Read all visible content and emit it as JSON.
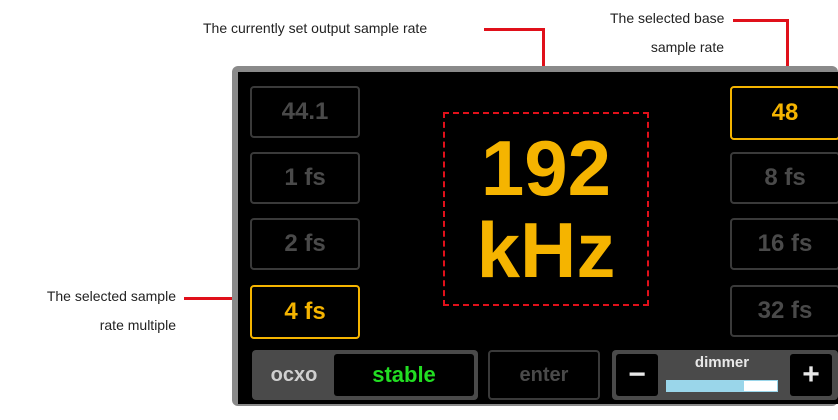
{
  "annotations": {
    "output_rate": "The currently set output sample rate",
    "base_rate_line1": "The selected base",
    "base_rate_line2": "sample rate",
    "multiple_line1": "The selected sample",
    "multiple_line2": "rate multiple"
  },
  "left_buttons": [
    {
      "label": "44.1",
      "selected": false
    },
    {
      "label": "1 fs",
      "selected": false
    },
    {
      "label": "2 fs",
      "selected": false
    },
    {
      "label": "4 fs",
      "selected": true
    }
  ],
  "right_buttons": [
    {
      "label": "48",
      "selected": true
    },
    {
      "label": "8 fs",
      "selected": false
    },
    {
      "label": "16 fs",
      "selected": false
    },
    {
      "label": "32 fs",
      "selected": false
    }
  ],
  "display": {
    "value": "192",
    "unit": "kHz"
  },
  "ocxo": {
    "label": "ocxo",
    "status": "stable"
  },
  "enter_label": "enter",
  "dimmer": {
    "label": "dimmer",
    "minus": "−",
    "plus": "+",
    "level_fraction": 0.7
  },
  "colors": {
    "accent": "#f5b400",
    "inactive": "#4a4a4a",
    "status_ok": "#22dd22",
    "annotation": "#e0101a"
  }
}
